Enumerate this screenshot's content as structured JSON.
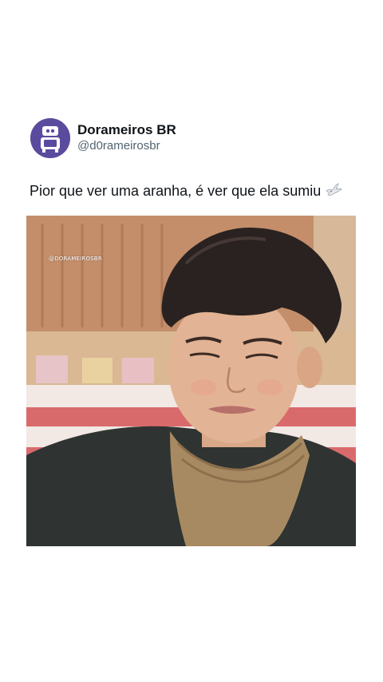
{
  "post": {
    "author": {
      "display_name": "Dorameiros BR",
      "handle": "@d0rameirosbr",
      "avatar_icon": "tv-character-avatar",
      "avatar_color": "#5b4b9e"
    },
    "text": "Pior que ver uma aranha, é ver que ela sumiu",
    "emoji_icon": "dove-icon",
    "media": {
      "watermark": "@DORAMEIROSBR",
      "description_icon": "photo-person-squinting"
    }
  },
  "colors": {
    "text_primary": "#0f1419",
    "text_secondary": "#536471",
    "background": "#ffffff"
  }
}
